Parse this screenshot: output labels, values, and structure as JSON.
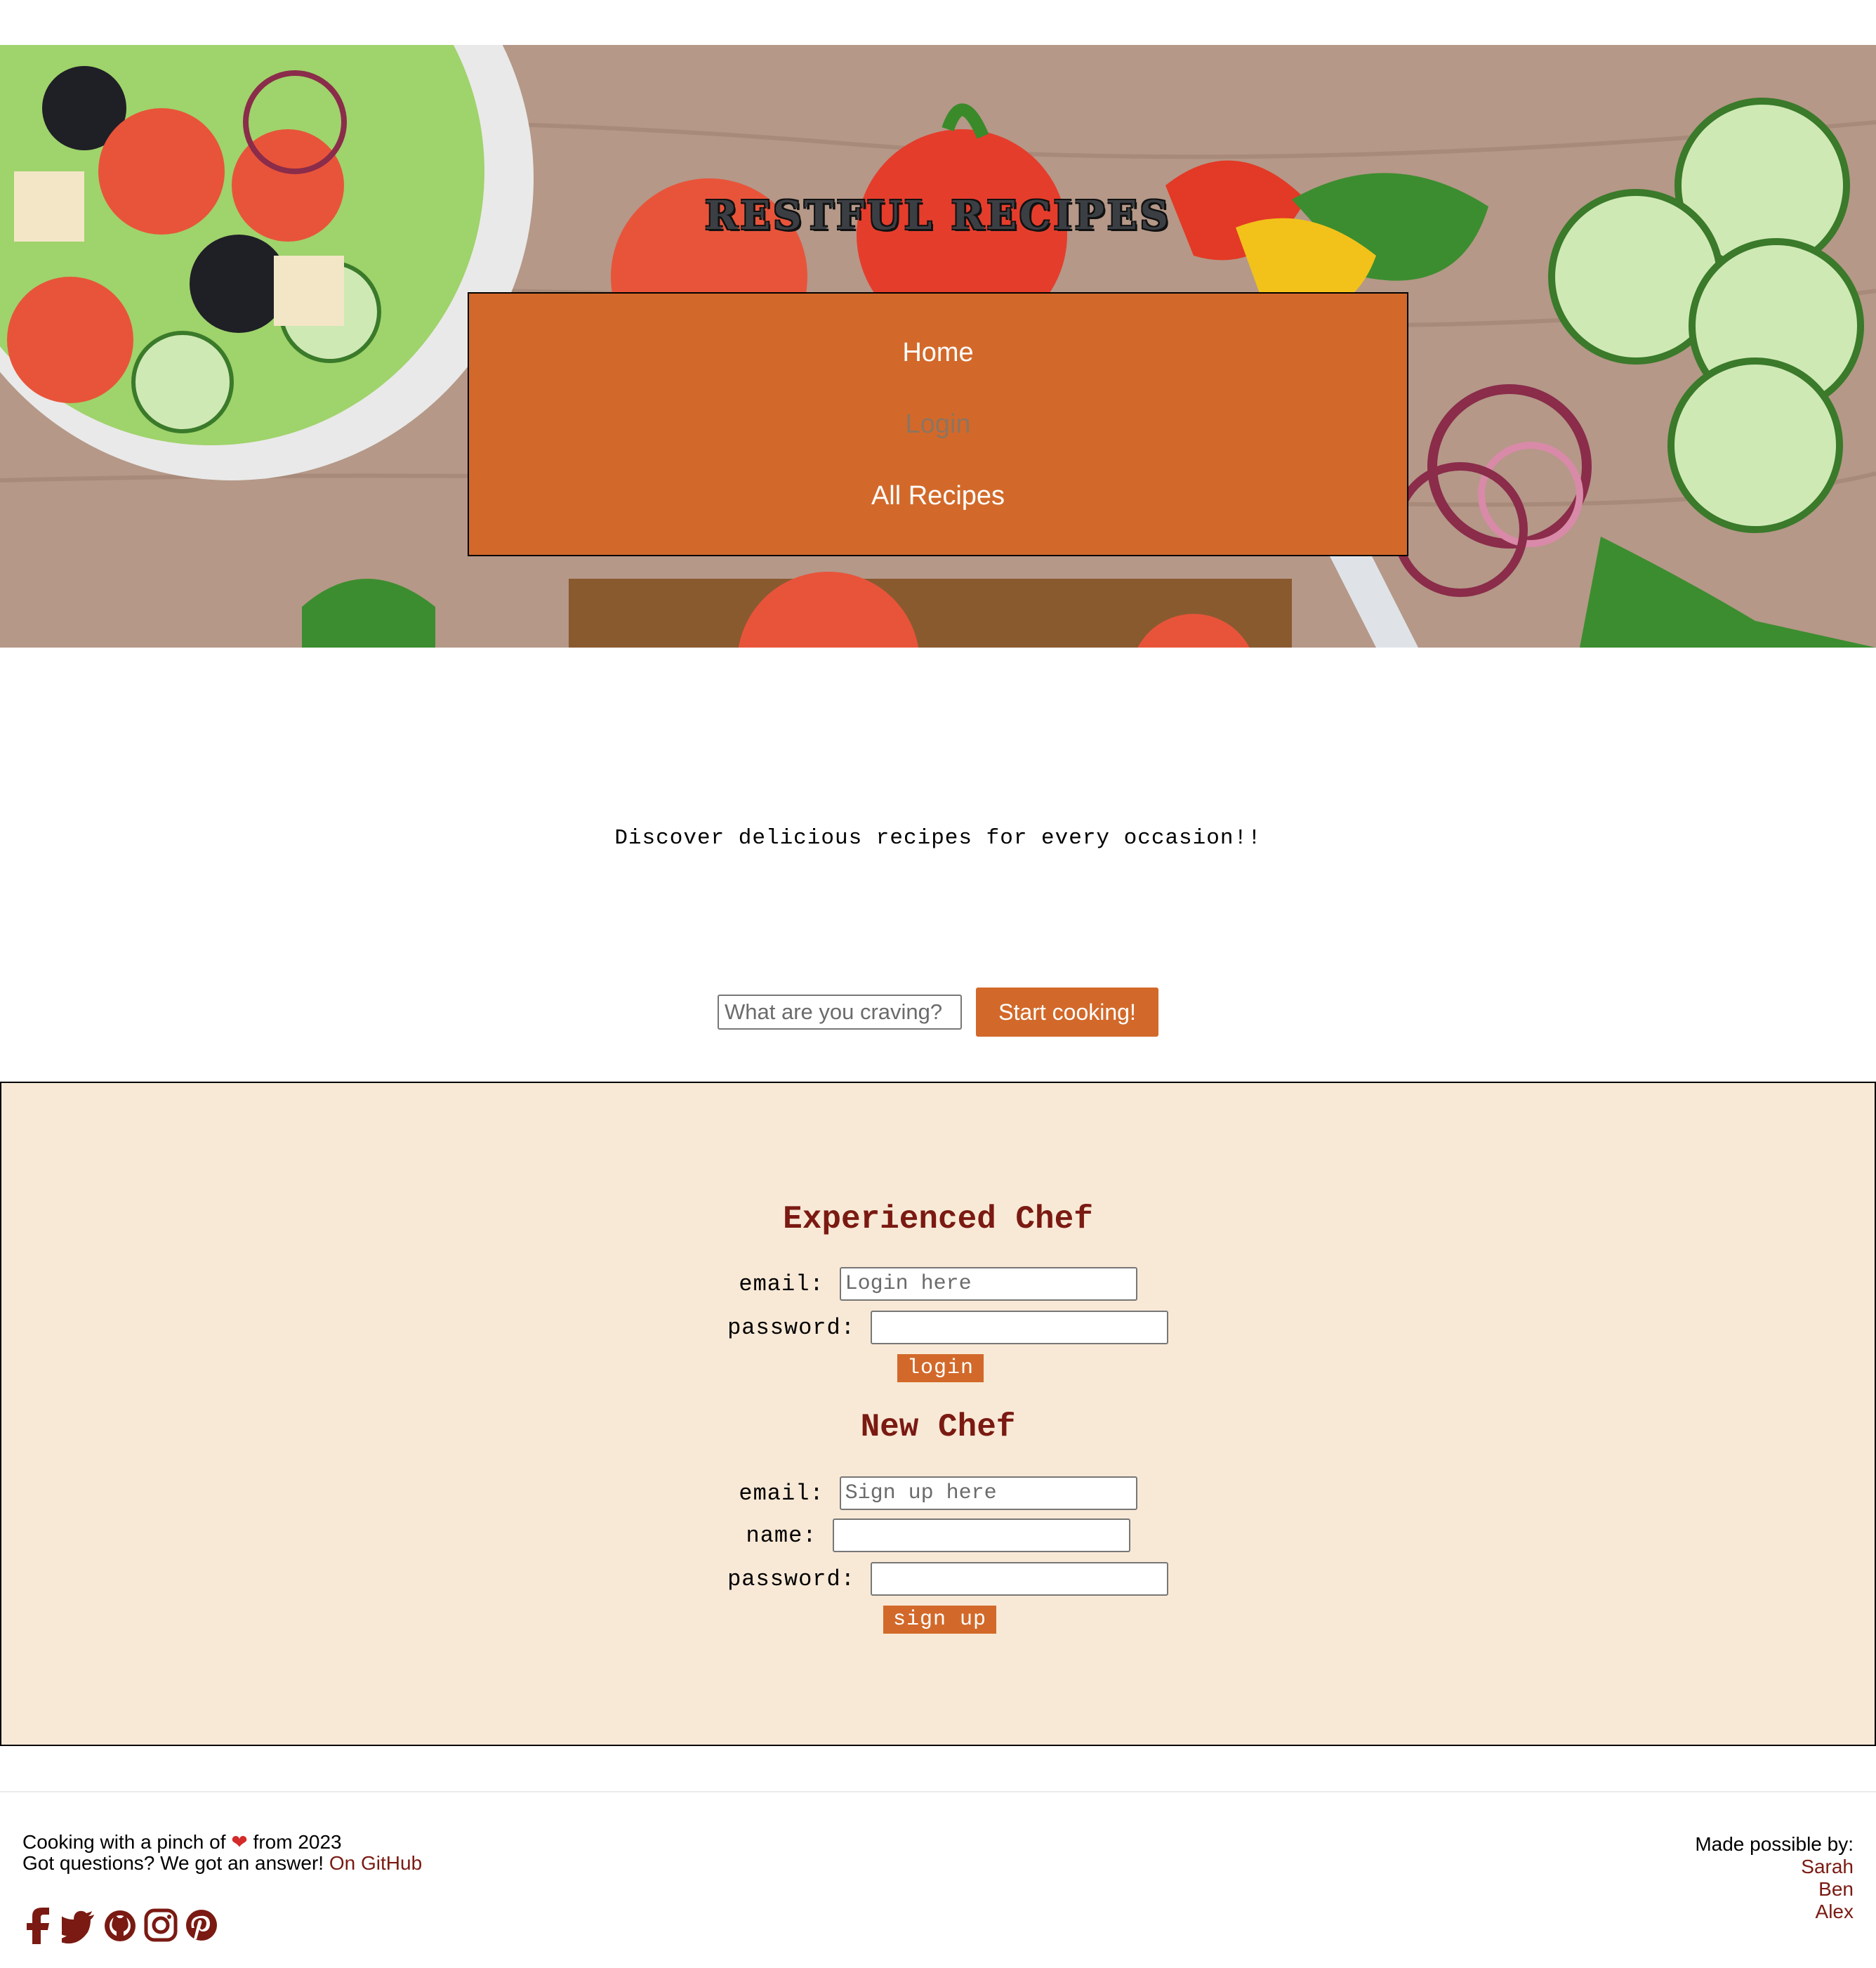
{
  "header": {
    "title": "RESTFUL RECIPES"
  },
  "nav": {
    "items": [
      {
        "label": "Home"
      },
      {
        "label": "Login"
      },
      {
        "label": "All Recipes"
      }
    ]
  },
  "main": {
    "tagline": "Discover delicious recipes for every occasion!!",
    "search": {
      "placeholder": "What are you craving?",
      "button": "Start cooking!"
    }
  },
  "login": {
    "heading": "Experienced Chef",
    "email_label": "email:",
    "email_placeholder": "Login here",
    "password_label": "password:",
    "button": "login"
  },
  "signup": {
    "heading": "New Chef",
    "email_label": "email:",
    "email_placeholder": "Sign up here",
    "name_label": "name:",
    "password_label": "password:",
    "button": "sign up"
  },
  "footer": {
    "line1_before": "Cooking with a pinch of",
    "line1_after": " from 2023",
    "line2_text": "Got questions? We got an answer!",
    "line2_link": "On GitHub",
    "credits_label": "Made possible by:",
    "credits": [
      "Sarah",
      "Ben",
      "Alex"
    ],
    "social_icons": [
      "facebook-icon",
      "twitter-icon",
      "github-icon",
      "instagram-icon",
      "pinterest-icon"
    ]
  },
  "colors": {
    "accent": "#d2692a",
    "heading": "#7a1a12",
    "panel": "#f8e9d6",
    "link": "#7a1a12"
  }
}
